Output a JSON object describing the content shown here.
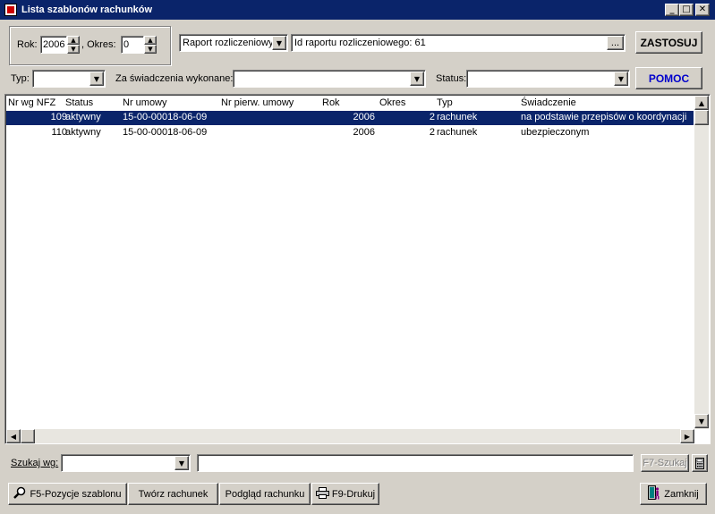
{
  "window": {
    "title": "Lista szablonów rachunków"
  },
  "filters": {
    "rok_label": "Rok:",
    "rok_value": "2006",
    "okres_label": ", Okres:",
    "okres_value": "0",
    "report_type": "Raport rozliczeniowy",
    "report_id_label": "Id raportu rozliczeniowego:  61",
    "browse_label": "...",
    "apply_label": "ZASTOSUJ",
    "typ_label": "Typ:",
    "typ_value": "",
    "za_label": "Za świadczenia wykonane:",
    "za_value": "",
    "status_label": "Status:",
    "status_value": "",
    "help_label": "POMOC"
  },
  "table": {
    "columns": [
      "Nr wg NFZ",
      "Status",
      "Nr umowy",
      "Nr pierw. umowy",
      "Rok",
      "Okres",
      "Typ",
      "Świadczenie"
    ],
    "rows": [
      {
        "nr": "109",
        "status": "aktywny",
        "umowa": "15-00-00018-06-09",
        "pierw": "",
        "rok": "2006",
        "okres": "2",
        "typ": "rachunek",
        "swiadczenie": "na podstawie przepisów o koordynacji"
      },
      {
        "nr": "110",
        "status": "aktywny",
        "umowa": "15-00-00018-06-09",
        "pierw": "",
        "rok": "2006",
        "okres": "2",
        "typ": "rachunek",
        "swiadczenie": "ubezpieczonym"
      }
    ],
    "selected_row": 0
  },
  "search": {
    "label": "Szukaj wg:",
    "field_value": "",
    "query_value": "",
    "search_button": "F7-Szukaj"
  },
  "toolbar": {
    "positions_label": "F5-Pozycje szablonu",
    "create_label": "Twórz rachunek",
    "preview_label": "Podgląd rachunku",
    "print_label": "F9-Drukuj",
    "close_label": "Zamknij"
  },
  "colors": {
    "selection": "#0a246a",
    "help_text": "#0000cc",
    "face": "#d4d0c8"
  },
  "icons": [
    "app-icon",
    "minimize-icon",
    "maximize-icon",
    "close-icon",
    "magnifier-icon",
    "printer-icon",
    "calculator-icon",
    "exit-icon"
  ]
}
